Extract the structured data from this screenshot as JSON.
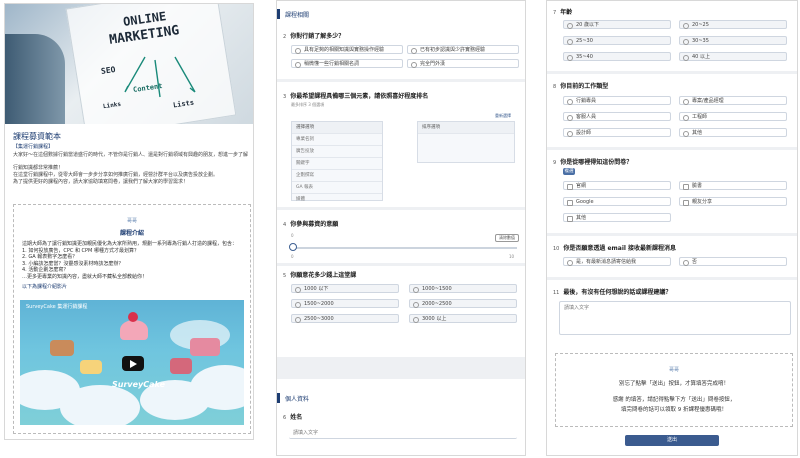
{
  "panel1": {
    "hero_words": [
      "ONLINE",
      "MARKETING",
      "SEO",
      "Content",
      "Lists",
      "Links"
    ],
    "title": "課程募資範本",
    "intro_heading": "【集運行銷課程】",
    "intro_lines": [
      "大家好～在這個數據行銷當道盛行的時代，不管你是行銷人、還是對行銷領域有興趣的朋友，想進一步了解",
      "行銷知識都非常推薦！",
      "在這堂行銷課程中，從零大師會一步步分享如何推廣行銷，經營計群平台以及廣告投放企劃。",
      "為了提供更好的課程內容，請大家協助填寫問卷，讓我們了解大家的學習需求！"
    ],
    "box_small": "哥哥",
    "box_title": "課程介紹",
    "box_lines": [
      "這期大師為了讓行銷知識更加親民優化為大家所熟用，規劃一系列專為行銷人打造的課程，包含：",
      "1. 如何投放廣告，CPC 和 CPM 哪種方式才最划算？",
      "2. GA 報表數字怎麼看？",
      "3. 小編該怎麼當？沒靈感沒素材時該怎麼辦？",
      "4. 活動企劃怎麼寫？",
      "…更多更專業的知識內容，盡就大師不藏私全部教給你！"
    ],
    "video_label": "以下為課程介紹影片",
    "video_title": "SurveyCake 集運行銷課程",
    "logo_text": "SurveyCake"
  },
  "panel2": {
    "section1_title": "課程相關",
    "q2": {
      "num": "2",
      "text": "你對行銷了解多少？",
      "options": [
        "具有足夠的相關知識與實務操作經驗",
        "已有初步認識與少許實務經驗",
        "稍微懂一些行銷相關名詞",
        "完全門外漢"
      ]
    },
    "q3": {
      "num": "3",
      "text": "你最希望課程具備哪三個元素，請依照喜好程度排名",
      "hint": "最多排序 3 個選項",
      "left_header": "選擇選項",
      "right_header": "排序選項",
      "reset": "重新選擇",
      "items": [
        "專業名詞",
        "廣告投放",
        "關鍵字",
        "企劃撰寫",
        "GA 報表",
        "媒體"
      ]
    },
    "q4": {
      "num": "4",
      "text": "你參與募資的意願",
      "min": "0",
      "max": "10",
      "button": "清除數值",
      "level": 0
    },
    "q5": {
      "num": "5",
      "text": "你願意花多少錢上這堂課",
      "options": [
        "1000 以下",
        "1000~1500",
        "1500~2000",
        "2000~2500",
        "2500~3000",
        "3000 以上"
      ]
    },
    "section2_title": "個人資料",
    "q6": {
      "num": "6",
      "text": "姓名",
      "placeholder": "請填入文字"
    }
  },
  "panel3": {
    "q7": {
      "num": "7",
      "text": "年齡",
      "options": [
        "20 歲以下",
        "20~25",
        "25~30",
        "30~35",
        "35~40",
        "40 以上"
      ]
    },
    "q8": {
      "num": "8",
      "text": "你目前的工作類型",
      "options": [
        "行銷專員",
        "專案/產品經理",
        "客服人員",
        "工程師",
        "設計師",
        "其他"
      ]
    },
    "q9": {
      "num": "9",
      "text": "你是從哪裡得知這份問卷？",
      "tag": "複選",
      "options": [
        "官網",
        "臉書",
        "Google",
        "親友分享",
        "其他"
      ]
    },
    "q10": {
      "num": "10",
      "text": "你是否願意透過 email 接收最新課程消息",
      "options": [
        "是，有最新消息請寄信給我",
        "否"
      ]
    },
    "q11": {
      "num": "11",
      "text": "最後，有沒有任何想說的話或課程建議？",
      "placeholder": "請填入文字"
    },
    "note_small": "哥哥",
    "note_line1": "別忘了點擊「送出」按鈕，才算填答完成唷！",
    "note_line2": "感謝 的填答，請記得點擊下方「送出」問卷按鈕，",
    "note_line3": "填完問卷的話可以領取 9 折課程優惠碼哦！",
    "submit": "送出"
  }
}
